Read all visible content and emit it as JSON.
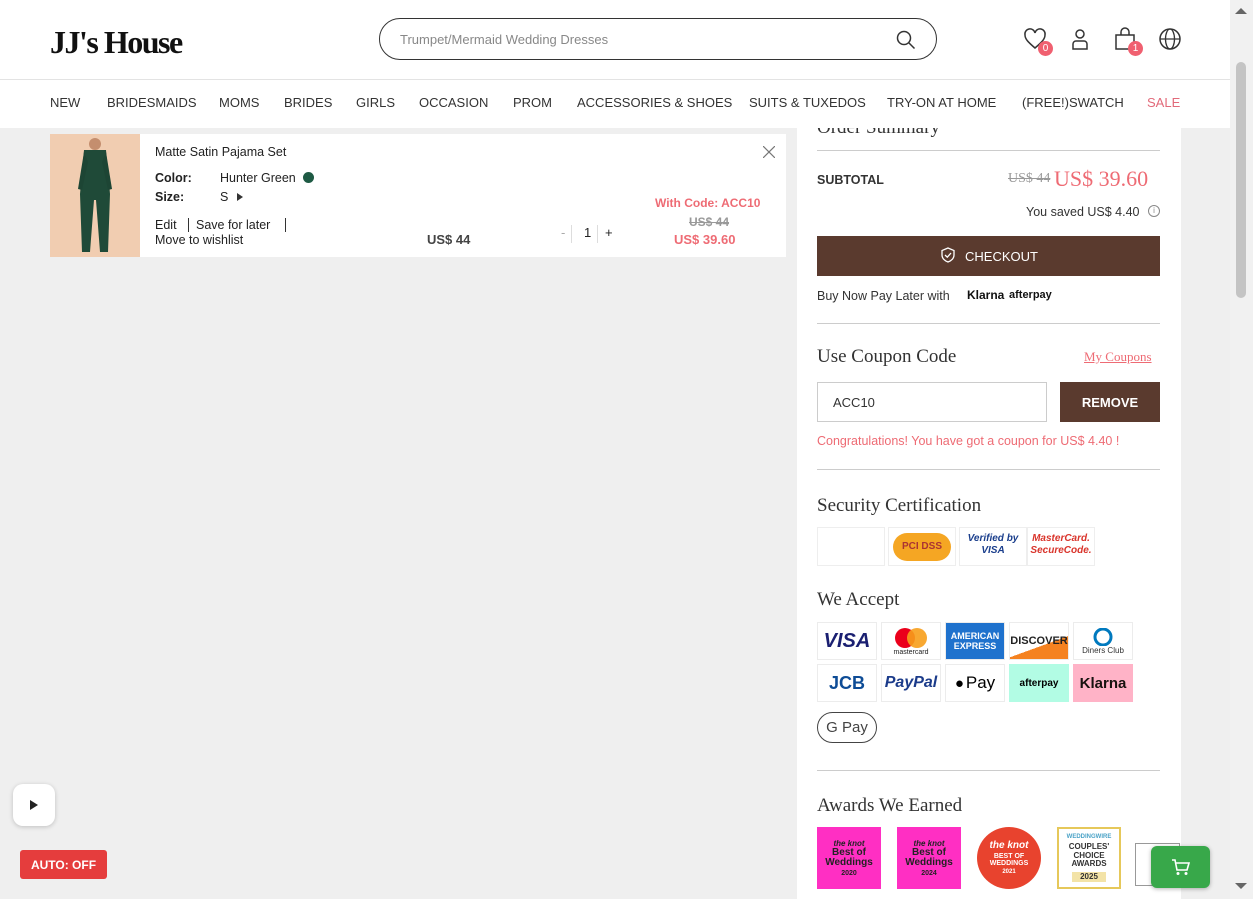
{
  "brand": {
    "logo": "JJ's House"
  },
  "search": {
    "placeholder": "Trumpet/Mermaid Wedding Dresses"
  },
  "header_icons": {
    "wishlist_count": "0",
    "bag_count": "1"
  },
  "nav": {
    "items": [
      "NEW",
      "BRIDESMAIDS",
      "MOMS",
      "BRIDES",
      "GIRLS",
      "OCCASION",
      "PROM",
      "ACCESSORIES & SHOES",
      "SUITS & TUXEDOS",
      "TRY-ON AT HOME",
      "(FREE!)SWATCH",
      "SALE"
    ]
  },
  "cart_item": {
    "name": "Matte Satin Pajama Set",
    "color_label": "Color:",
    "color_value": "Hunter Green",
    "color_hex": "#1e5a44",
    "size_label": "Size:",
    "size_value": "S",
    "edit": "Edit",
    "save_for_later": "Save for later",
    "move_to_wishlist": "Move to wishlist",
    "unit_price": "US$ 44",
    "quantity": "1",
    "minus": "-",
    "plus": "+",
    "code_note": "With Code: ACC10",
    "original_price": "US$ 44",
    "discounted_price": "US$ 39.60"
  },
  "summary": {
    "title": "Order Summary",
    "subtotal_label": "SUBTOTAL",
    "subtotal_original": "US$ 44",
    "subtotal_final": "US$ 39.60",
    "saved": "You saved US$ 4.40",
    "checkout": "CHECKOUT",
    "bnpl_label": "Buy Now Pay Later with",
    "bnpl_klarna": "Klarna",
    "bnpl_afterpay": "afterpay"
  },
  "coupon": {
    "title": "Use Coupon Code",
    "my_coupons": "My Coupons",
    "code": "ACC10",
    "remove": "REMOVE",
    "message": "Congratulations! You have got a coupon for US$ 4.40 !"
  },
  "security": {
    "title": "Security Certification",
    "badges": [
      "PCI DSS",
      "Verified by VISA",
      "MasterCard. SecureCode."
    ]
  },
  "accept": {
    "title": "We Accept",
    "visa": "VISA",
    "mastercard": "mastercard",
    "amex": "AMERICAN EXPRESS",
    "discover": "DISCOVER",
    "diners": "Diners Club",
    "jcb": "JCB",
    "paypal": "PayPal",
    "applepay": "Pay",
    "afterpay": "afterpay",
    "klarna": "Klarna",
    "gpay": "G Pay"
  },
  "awards": {
    "title": "Awards We Earned",
    "items": [
      {
        "brand": "the knot",
        "name": "Best of Weddings",
        "year": "2020"
      },
      {
        "brand": "the knot",
        "name": "Best of Weddings",
        "year": "2024"
      },
      {
        "brand": "the knot",
        "name": "BEST OF WEDDINGS",
        "year": "2021"
      },
      {
        "brand": "WEDDINGWIRE",
        "name": "COUPLES' CHOICE AWARDS",
        "year": "2025"
      }
    ]
  },
  "floating": {
    "auto": "AUTO: OFF"
  },
  "colors": {
    "brown": "#5a3a2e",
    "pink": "#ee6b74",
    "sale": "#e26a7a",
    "green": "#38a84a"
  }
}
